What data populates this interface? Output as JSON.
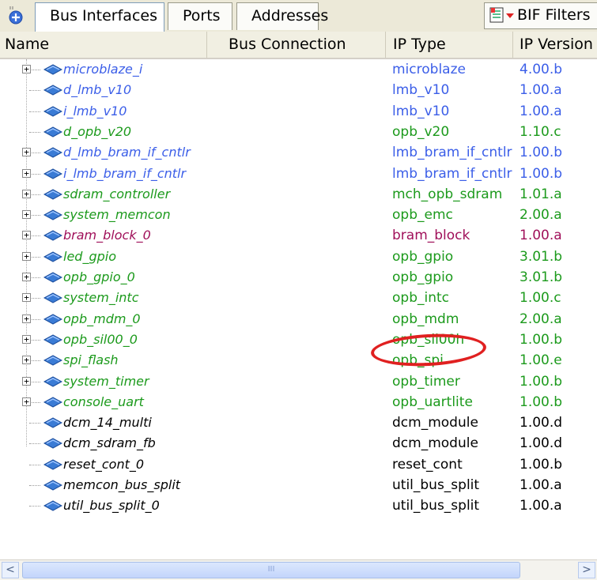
{
  "tabs": [
    {
      "label": "Bus Interfaces",
      "active": true
    },
    {
      "label": "Ports",
      "active": false
    },
    {
      "label": "Addresses",
      "active": false
    }
  ],
  "bif_filters": {
    "label": "BIF Filters",
    "icon": "filter-icon"
  },
  "columns": [
    "Name",
    "Bus Connection",
    "IP Type",
    "IP Version"
  ],
  "colors": {
    "blue": "#3b5ee8",
    "green": "#1c9a1c",
    "maroon": "#a0105a",
    "black": "#000000",
    "highlight": "#e02020"
  },
  "rows": [
    {
      "name": "microblaze_i",
      "ip_type": "microblaze",
      "ip_version": "4.00.b",
      "color": "blue",
      "expandable": true
    },
    {
      "name": "d_lmb_v10",
      "ip_type": "lmb_v10",
      "ip_version": "1.00.a",
      "color": "blue",
      "expandable": false
    },
    {
      "name": "i_lmb_v10",
      "ip_type": "lmb_v10",
      "ip_version": "1.00.a",
      "color": "blue",
      "expandable": false
    },
    {
      "name": "d_opb_v20",
      "ip_type": "opb_v20",
      "ip_version": "1.10.c",
      "color": "green",
      "expandable": false
    },
    {
      "name": "d_lmb_bram_if_cntlr",
      "ip_type": "lmb_bram_if_cntlr",
      "ip_version": "1.00.b",
      "color": "blue",
      "expandable": true
    },
    {
      "name": "i_lmb_bram_if_cntlr",
      "ip_type": "lmb_bram_if_cntlr",
      "ip_version": "1.00.b",
      "color": "blue",
      "expandable": true
    },
    {
      "name": "sdram_controller",
      "ip_type": "mch_opb_sdram",
      "ip_version": "1.01.a",
      "color": "green",
      "expandable": true
    },
    {
      "name": "system_memcon",
      "ip_type": "opb_emc",
      "ip_version": "2.00.a",
      "color": "green",
      "expandable": true
    },
    {
      "name": "bram_block_0",
      "ip_type": "bram_block",
      "ip_version": "1.00.a",
      "color": "maroon",
      "expandable": true
    },
    {
      "name": "led_gpio",
      "ip_type": "opb_gpio",
      "ip_version": "3.01.b",
      "color": "green",
      "expandable": true
    },
    {
      "name": "opb_gpio_0",
      "ip_type": "opb_gpio",
      "ip_version": "3.01.b",
      "color": "green",
      "expandable": true
    },
    {
      "name": "system_intc",
      "ip_type": "opb_intc",
      "ip_version": "1.00.c",
      "color": "green",
      "expandable": true
    },
    {
      "name": "opb_mdm_0",
      "ip_type": "opb_mdm",
      "ip_version": "2.00.a",
      "color": "green",
      "expandable": true
    },
    {
      "name": "opb_sil00_0",
      "ip_type": "opb_sil00h",
      "ip_version": "1.00.b",
      "color": "green",
      "expandable": true
    },
    {
      "name": "spi_flash",
      "ip_type": "opb_spi",
      "ip_version": "1.00.e",
      "color": "green",
      "expandable": true
    },
    {
      "name": "system_timer",
      "ip_type": "opb_timer",
      "ip_version": "1.00.b",
      "color": "green",
      "expandable": true
    },
    {
      "name": "console_uart",
      "ip_type": "opb_uartlite",
      "ip_version": "1.00.b",
      "color": "green",
      "expandable": true
    },
    {
      "name": "dcm_14_multi",
      "ip_type": "dcm_module",
      "ip_version": "1.00.d",
      "color": "black",
      "expandable": false
    },
    {
      "name": "dcm_sdram_fb",
      "ip_type": "dcm_module",
      "ip_version": "1.00.d",
      "color": "black",
      "expandable": false
    },
    {
      "name": "reset_cont_0",
      "ip_type": "reset_cont",
      "ip_version": "1.00.b",
      "color": "black",
      "expandable": false
    },
    {
      "name": "memcon_bus_split",
      "ip_type": "util_bus_split",
      "ip_version": "1.00.a",
      "color": "black",
      "expandable": false
    },
    {
      "name": "util_bus_split_0",
      "ip_type": "util_bus_split",
      "ip_version": "1.00.a",
      "color": "black",
      "expandable": false
    }
  ],
  "highlighted_row": "opb_sil00_0",
  "scrollbar": {
    "left_arrow": "<",
    "right_arrow": ">",
    "thumb_grip": "III"
  }
}
